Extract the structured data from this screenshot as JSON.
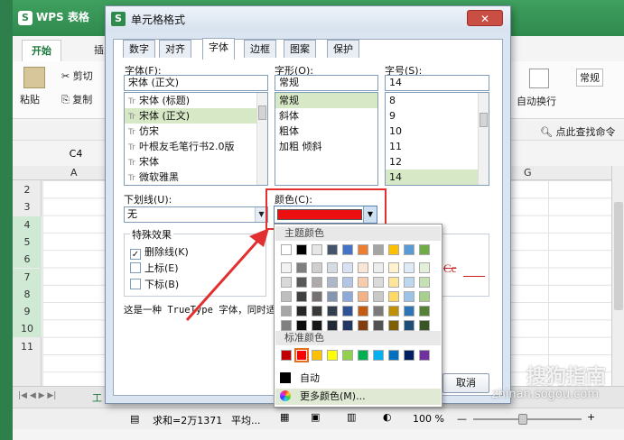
{
  "app": {
    "title": "WPS 表格",
    "logo": "S"
  },
  "ribbon": {
    "tab_home": "开始",
    "tab_insert": "插入",
    "cut": "剪切",
    "paste": "粘贴",
    "copy": "复制",
    "auto_wrap": "自动换行",
    "normal": "常规",
    "find": "点此查找命令"
  },
  "sheet": {
    "namebox": "C4",
    "col_a": "A",
    "col_g": "G",
    "rows": [
      "2",
      "3",
      "4",
      "5",
      "6",
      "7",
      "8",
      "9",
      "10",
      "11"
    ],
    "highlighted_rows": [
      "4",
      "5",
      "6",
      "7",
      "8",
      "9",
      "10"
    ],
    "sheet_tab": "工"
  },
  "status": {
    "sum": "求和=2万1371",
    "avg": "平均...",
    "zoom": "100 %"
  },
  "dialog": {
    "title": "单元格格式",
    "close_symbol": "✕",
    "tabs": [
      "数字",
      "对齐",
      "字体",
      "边框",
      "图案",
      "保护"
    ],
    "active_tab": "字体",
    "font_label": "字体(F):",
    "font_value": "宋体 (正文)",
    "font_list": [
      "宋体 (标题)",
      "宋体 (正文)",
      "仿宋",
      "叶根友毛笔行书2.0版",
      "宋体",
      "微软雅黑"
    ],
    "font_selected_index": 1,
    "style_label": "字形(O):",
    "style_value": "常规",
    "style_list": [
      "常规",
      "斜体",
      "粗体",
      "加粗 倾斜"
    ],
    "size_label": "字号(S):",
    "size_value": "14",
    "size_list": [
      "8",
      "9",
      "10",
      "11",
      "12",
      "14"
    ],
    "underline_label": "下划线(U):",
    "underline_value": "无",
    "color_label": "颜色(C):",
    "color_value": "#ee1010",
    "effects_title": "特殊效果",
    "strikethrough": "删除线(K)",
    "superscript": "上标(E)",
    "subscript": "下标(B)",
    "strike_checked": true,
    "preview_text": "Cc",
    "description": "这是一种 TrueType 字体，同时适",
    "cancel": "取消"
  },
  "palette": {
    "theme_title": "主题颜色",
    "standard_title": "标准颜色",
    "auto": "自动",
    "more": "更多颜色(M)...",
    "theme_row": [
      "#ffffff",
      "#000000",
      "#e7e6e6",
      "#44546a",
      "#4472c4",
      "#ed7d31",
      "#a5a5a5",
      "#ffc000",
      "#5b9bd5",
      "#70ad47"
    ],
    "tint_columns": [
      [
        "#f2f2f2",
        "#d9d9d9",
        "#bfbfbf",
        "#a6a6a6",
        "#808080"
      ],
      [
        "#7f7f7f",
        "#595959",
        "#404040",
        "#262626",
        "#0d0d0d"
      ],
      [
        "#d0cece",
        "#aeaaaa",
        "#757171",
        "#3b3838",
        "#161616"
      ],
      [
        "#d6dce4",
        "#adb9ca",
        "#8496b0",
        "#323f4f",
        "#222a35"
      ],
      [
        "#d9e2f3",
        "#b4c6e7",
        "#8eaadb",
        "#2f5496",
        "#1f3864"
      ],
      [
        "#fbe5d5",
        "#f7cbac",
        "#f4b183",
        "#c55a11",
        "#833c0b"
      ],
      [
        "#ededed",
        "#dbdbdb",
        "#c9c9c9",
        "#7b7b7b",
        "#525252"
      ],
      [
        "#fff2cc",
        "#fee599",
        "#ffd966",
        "#bf9000",
        "#7f6000"
      ],
      [
        "#deebf6",
        "#bdd7ee",
        "#9dc3e6",
        "#2e75b5",
        "#1f4e79"
      ],
      [
        "#e2efd9",
        "#c5e0b3",
        "#a8d08d",
        "#538135",
        "#375623"
      ]
    ],
    "standard_row": [
      "#c00000",
      "#ff0000",
      "#ffc000",
      "#ffff00",
      "#92d050",
      "#00b050",
      "#00b0f0",
      "#0070c0",
      "#002060",
      "#7030a0"
    ],
    "selected_standard_index": 1
  },
  "watermark": {
    "brand": "搜狗指南",
    "url": "zhinan.sogou.com"
  }
}
